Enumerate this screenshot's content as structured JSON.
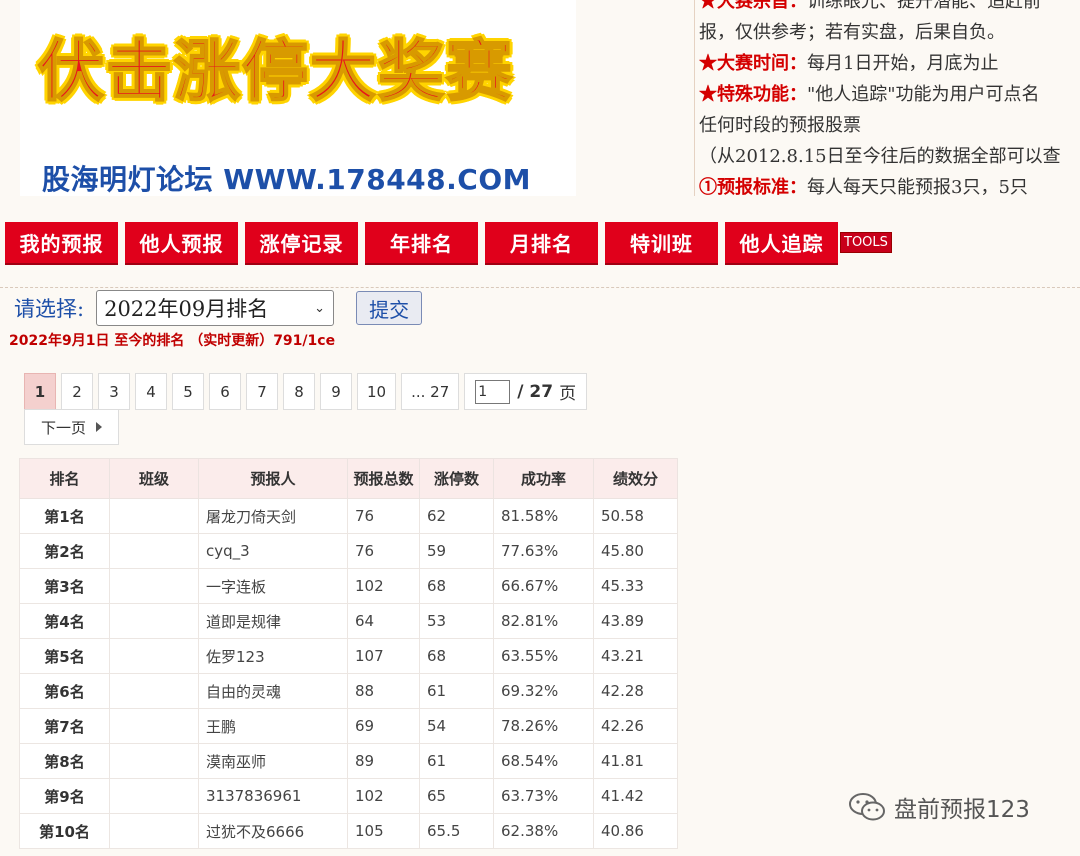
{
  "banner": {
    "title": "伏击涨停大奖赛",
    "subtitle": "股海明灯论坛 WWW.178448.COM"
  },
  "rules": {
    "line1_star": "★大赛宗旨：",
    "line1_text": "训练眼光、提升潜能、追赶前",
    "line2": "报，仅供参考；若有实盘，后果自负。",
    "line3_star": "★大赛时间：",
    "line3_text": "每月1日开始，月底为止",
    "line4_star": "★特殊功能：",
    "line4_text": "\"他人追踪\"功能为用户可点名",
    "line5": "任何时段的预报股票",
    "line6": "（从2012.8.15日至今往后的数据全部可以查",
    "line7_star": "①预报标准：",
    "line7_text": "每人每天只能预报3只，5只"
  },
  "nav": {
    "items": [
      "我的预报",
      "他人预报",
      "涨停记录",
      "年排名",
      "月排名",
      "特训班",
      "他人追踪"
    ],
    "tools": "TOOLS"
  },
  "filter": {
    "label": "请选择:",
    "selected": "2022年09月排名",
    "submit": "提交",
    "range_note": "2022年9月1日 至今的排名 （实时更新）791/1ce"
  },
  "pager": {
    "pages": [
      "1",
      "2",
      "3",
      "4",
      "5",
      "6",
      "7",
      "8",
      "9",
      "10",
      "... 27"
    ],
    "current_input": "1",
    "total": "/ 27",
    "unit": "页",
    "next": "下一页"
  },
  "table": {
    "headers": [
      "排名",
      "班级",
      "预报人",
      "预报总数",
      "涨停数",
      "成功率",
      "绩效分"
    ],
    "rows": [
      [
        "第1名",
        "",
        "屠龙刀倚天剑",
        "76",
        "62",
        "81.58%",
        "50.58"
      ],
      [
        "第2名",
        "",
        "cyq_3",
        "76",
        "59",
        "77.63%",
        "45.80"
      ],
      [
        "第3名",
        "",
        "一字连板",
        "102",
        "68",
        "66.67%",
        "45.33"
      ],
      [
        "第4名",
        "",
        "道即是规律",
        "64",
        "53",
        "82.81%",
        "43.89"
      ],
      [
        "第5名",
        "",
        "佐罗123",
        "107",
        "68",
        "63.55%",
        "43.21"
      ],
      [
        "第6名",
        "",
        "自由的灵魂",
        "88",
        "61",
        "69.32%",
        "42.28"
      ],
      [
        "第7名",
        "",
        "王鹏",
        "69",
        "54",
        "78.26%",
        "42.26"
      ],
      [
        "第8名",
        "",
        "漠南巫师",
        "89",
        "61",
        "68.54%",
        "41.81"
      ],
      [
        "第9名",
        "",
        "3137836961",
        "102",
        "65",
        "63.73%",
        "41.42"
      ],
      [
        "第10名",
        "",
        "过犹不及6666",
        "105",
        "65.5",
        "62.38%",
        "40.86"
      ]
    ]
  },
  "watermark": "盘前预报123"
}
